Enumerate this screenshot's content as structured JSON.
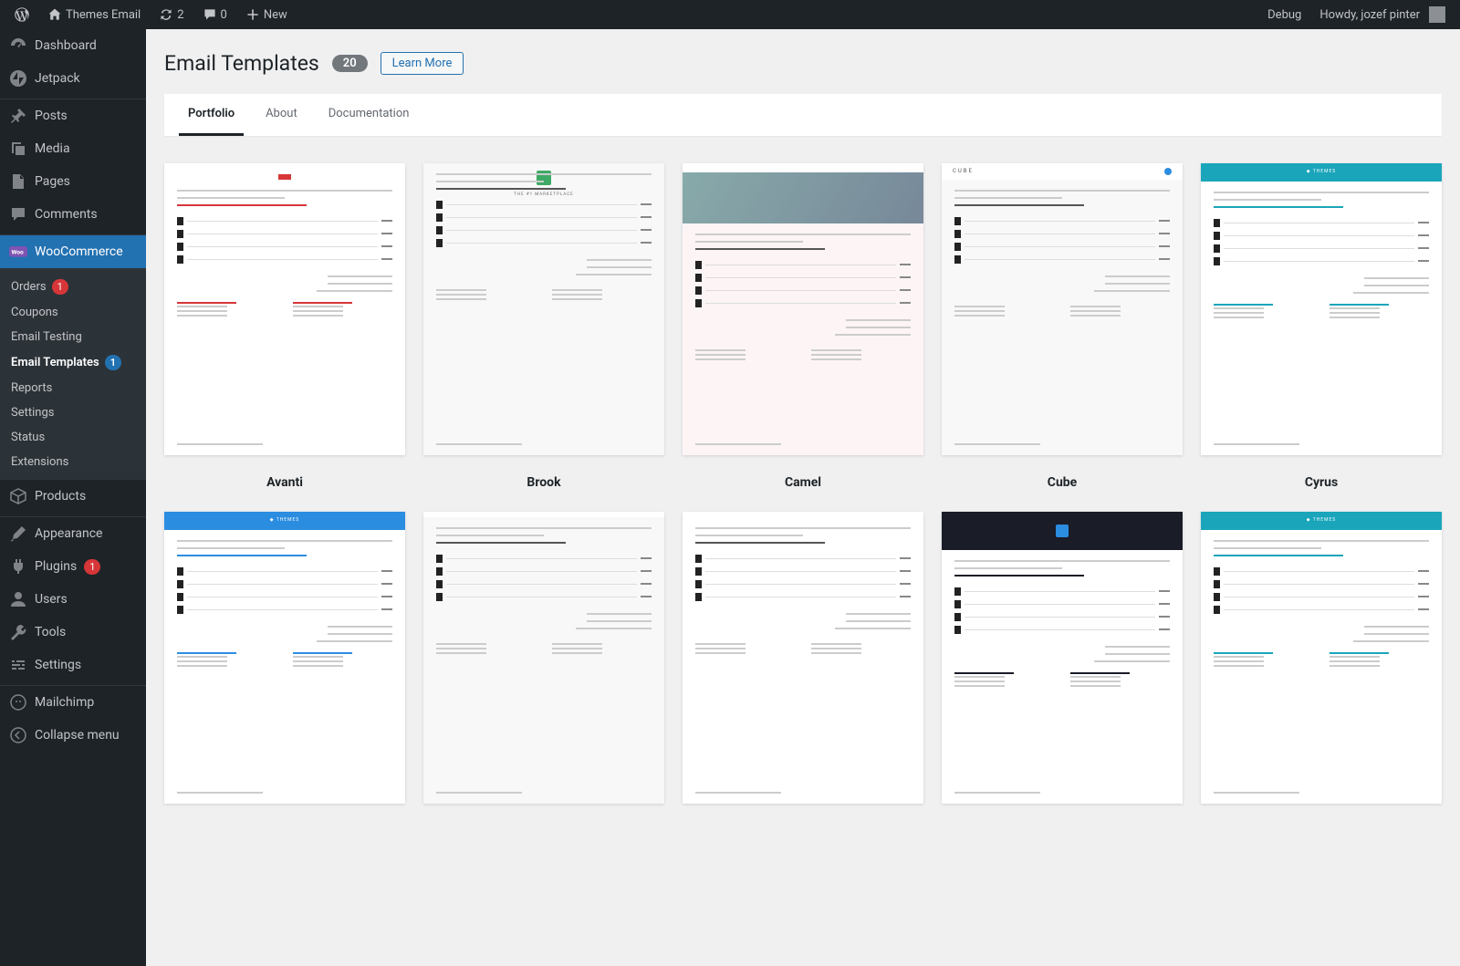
{
  "toolbar": {
    "site_name": "Themes Email",
    "updates_count": "2",
    "comments_count": "0",
    "new_label": "New",
    "debug_label": "Debug",
    "howdy": "Howdy, jozef pinter"
  },
  "menu": {
    "dashboard": "Dashboard",
    "jetpack": "Jetpack",
    "posts": "Posts",
    "media": "Media",
    "pages": "Pages",
    "comments": "Comments",
    "woocommerce": "WooCommerce",
    "products": "Products",
    "appearance": "Appearance",
    "plugins": "Plugins",
    "plugins_count": "1",
    "users": "Users",
    "tools": "Tools",
    "settings": "Settings",
    "mailchimp": "Mailchimp",
    "collapse": "Collapse menu"
  },
  "submenu": {
    "orders": "Orders",
    "orders_count": "1",
    "coupons": "Coupons",
    "email_testing": "Email Testing",
    "email_templates": "Email Templates",
    "email_templates_count": "1",
    "reports": "Reports",
    "settings": "Settings",
    "status": "Status",
    "extensions": "Extensions"
  },
  "page": {
    "title": "Email Templates",
    "count": "20",
    "learn_more": "Learn More"
  },
  "tabs": {
    "portfolio": "Portfolio",
    "about": "About",
    "documentation": "Documentation"
  },
  "templates": [
    {
      "name": "Avanti",
      "accent": "acc-red",
      "thumb_bg": ""
    },
    {
      "name": "Brook",
      "accent": "acc-grey",
      "thumb_bg": "shaded"
    },
    {
      "name": "Camel",
      "accent": "acc-camel",
      "thumb_bg": "pink"
    },
    {
      "name": "Cube",
      "accent": "acc-cube",
      "thumb_bg": "shaded"
    },
    {
      "name": "Cyrus",
      "accent": "acc-cyan",
      "thumb_bg": ""
    },
    {
      "name": "",
      "accent": "acc-blue",
      "thumb_bg": ""
    },
    {
      "name": "",
      "accent": "acc-null",
      "thumb_bg": "shaded"
    },
    {
      "name": "",
      "accent": "acc-null",
      "thumb_bg": ""
    },
    {
      "name": "",
      "accent": "acc-dark",
      "thumb_bg": ""
    },
    {
      "name": "",
      "accent": "acc-cyan",
      "thumb_bg": ""
    }
  ]
}
